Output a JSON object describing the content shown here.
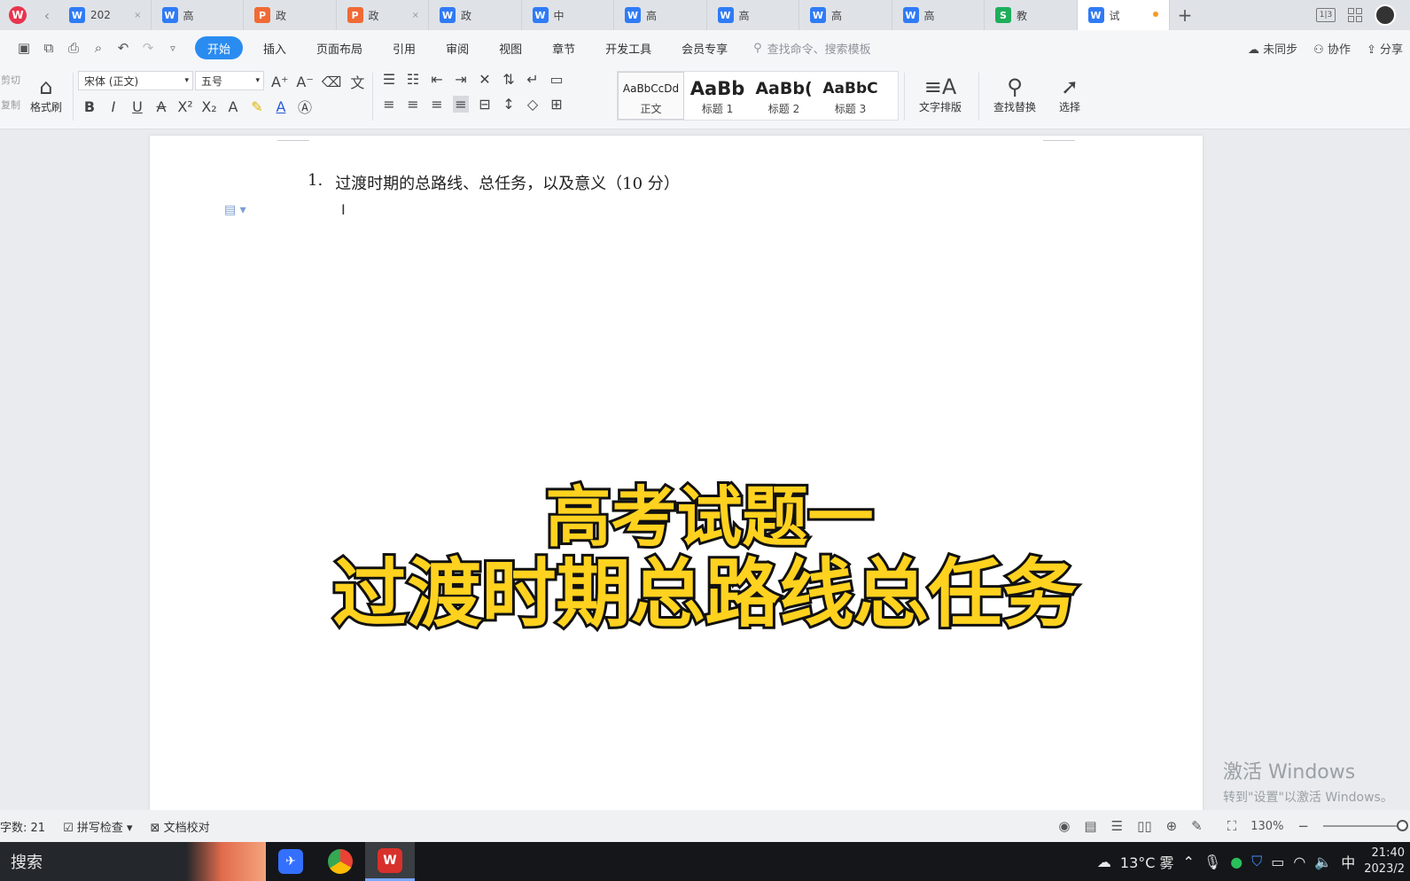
{
  "colors": {
    "accent": "#2a8cf0",
    "overlay_fill": "#ffd21f",
    "overlay_stroke": "#111111",
    "word_icon": "#2f7bf6",
    "ppt_icon": "#f06a35",
    "sheet_icon": "#1fae5b"
  },
  "tabs": [
    {
      "icon": "W",
      "kind": "word",
      "label": "202",
      "close": "×"
    },
    {
      "icon": "W",
      "kind": "word",
      "label": "高",
      "close": ""
    },
    {
      "icon": "P",
      "kind": "ppt",
      "label": "政",
      "close": ""
    },
    {
      "icon": "P",
      "kind": "ppt",
      "label": "政",
      "close": "×"
    },
    {
      "icon": "W",
      "kind": "word",
      "label": "政",
      "close": ""
    },
    {
      "icon": "W",
      "kind": "word",
      "label": "中",
      "close": ""
    },
    {
      "icon": "W",
      "kind": "word",
      "label": "高",
      "close": ""
    },
    {
      "icon": "W",
      "kind": "word",
      "label": "高",
      "close": ""
    },
    {
      "icon": "W",
      "kind": "word",
      "label": "高",
      "close": ""
    },
    {
      "icon": "W",
      "kind": "word",
      "label": "高",
      "close": ""
    },
    {
      "icon": "S",
      "kind": "sheet",
      "label": "教",
      "close": ""
    },
    {
      "icon": "W",
      "kind": "word",
      "label": "试",
      "close": "",
      "active": true,
      "modified": true
    }
  ],
  "tab_right": {
    "layout_label": "1|3"
  },
  "menu": {
    "items": [
      "开始",
      "插入",
      "页面布局",
      "引用",
      "审阅",
      "视图",
      "章节",
      "开发工具",
      "会员专享"
    ],
    "search_placeholder": "查找命令、搜索模板",
    "right": [
      "未同步",
      "协作",
      "分享"
    ]
  },
  "ribbon": {
    "clipboard": [
      "剪切",
      "复制"
    ],
    "format_painter": "格式刷",
    "font_name": "宋体 (正文)",
    "font_size": "五号",
    "styles": [
      {
        "sample": "AaBbCcDd",
        "label": "正文"
      },
      {
        "sample": "AaBb",
        "label": "标题 1"
      },
      {
        "sample": "AaBb(",
        "label": "标题 2"
      },
      {
        "sample": "AaBbC",
        "label": "标题 3"
      }
    ],
    "text_layout": "文字排版",
    "find_replace": "查找替换",
    "select": "选择"
  },
  "document": {
    "question_number": "1.",
    "question_text": "过渡时期的总路线、总任务，以及意义（10 分）"
  },
  "overlay": {
    "line1": "高考试题一",
    "line2": "过渡时期总路线总任务"
  },
  "watermark": {
    "line1": "激活 Windows",
    "line2": "转到\"设置\"以激活 Windows。"
  },
  "status": {
    "word_count": "字数: 21",
    "spell_check": "拼写检查",
    "doc_proof": "文档校对",
    "zoom": "130%",
    "zoom_level_percent": 130
  },
  "taskbar": {
    "search_label": "搜索",
    "weather": "13°C 雾",
    "ime": "中",
    "time": "21:40",
    "date": "2023/2"
  }
}
